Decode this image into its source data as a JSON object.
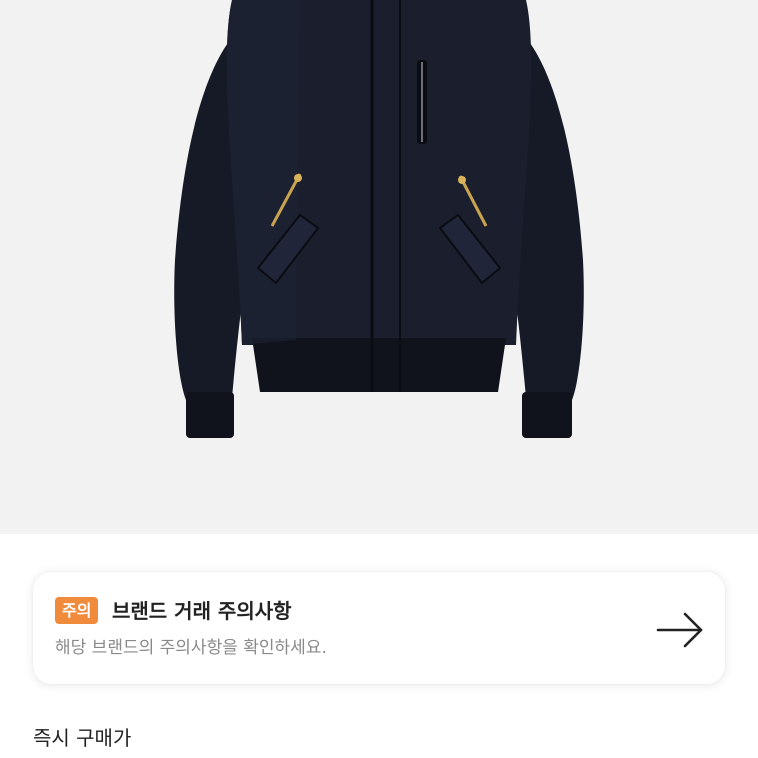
{
  "product": {
    "image_icon": "jacket-image"
  },
  "notice": {
    "badge": "주의",
    "title": "브랜드 거래 주의사항",
    "description": "해당 브랜드의 주의사항을 확인하세요.",
    "arrow_icon": "arrow-right-icon",
    "badge_color": "#f08b3c"
  },
  "section": {
    "title": "즉시 구매가"
  }
}
